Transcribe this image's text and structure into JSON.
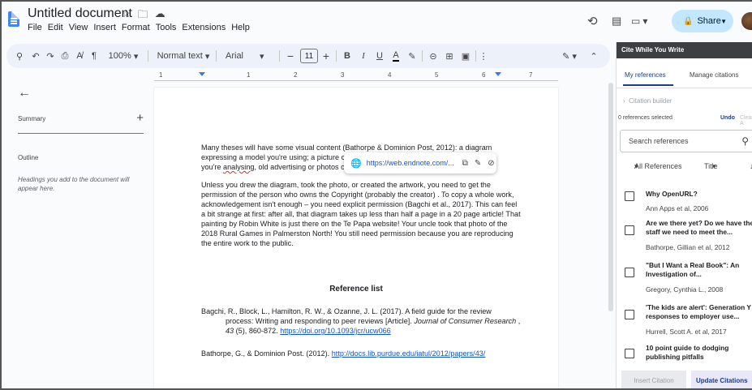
{
  "titlebar": {
    "doc_title": "Untitled document",
    "menu": [
      "File",
      "Edit",
      "View",
      "Insert",
      "Format",
      "Tools",
      "Extensions",
      "Help"
    ],
    "share_label": "Share"
  },
  "toolbar": {
    "zoom": "100%",
    "style": "Normal text",
    "font": "Arial",
    "font_size": "11",
    "bold": "B",
    "italic": "I",
    "underline": "U",
    "text_color": "A"
  },
  "ruler": [
    "1",
    "1",
    "2",
    "3",
    "4",
    "5",
    "6",
    "7"
  ],
  "left_panel": {
    "summary": "Summary",
    "outline": "Outline",
    "outline_hint": "Headings you add to the document will appear here."
  },
  "document": {
    "para1_a": "Many theses will have some visual content (Bathorpe & Dominion Post, 2012): a diagram expressing a model you're using; a picture c",
    "para1_b": "you're ",
    "para1_squiggle": "analysing",
    "para1_c": ", old advertising or photos c",
    "para2": "Unless you drew the diagram, took the photo, or created the artwork, you need to get the permission of the person who owns the Copyright (probably the creator) . To copy a whole work, acknowledgement isn't enough – you need explicit permission (Bagchi et al., 2017). This can feel a bit strange at first: after all, that diagram takes up less than half a page in a 20 page article! That painting by Robin White is just there on the Te Papa website! Your uncle took that photo of the 2018 Rural Games in Palmerston North! You still need permission because you are reproducing the entire work to the public.",
    "reference_heading": "Reference list",
    "ref1_a": "Bagchi, R., Block, L., Hamilton, R. W., & Ozanne, J. L. (2017). A field guide for the review",
    "ref1_b": "process: Writing and responding to peer reviews [Article].",
    "ref1_journal": "Journal of Consumer Research",
    "ref1_c": " ,",
    "ref1_vol": "43",
    "ref1_d": " (5), 860-872. ",
    "ref1_link": "https://doi.org/10.1093/jcr/ucw066",
    "ref2_a": "Bathorpe, G., & Dominion Post. (2012).  ",
    "ref2_link": "http://docs.lib.purdue.edu/iatul/2012/papers/43/",
    "link_chip": "https://web.endnote.com/..."
  },
  "side_panel": {
    "header": "Cite While You Write",
    "tabs": [
      "My references",
      "Manage citations"
    ],
    "citation_builder": "Citation builder",
    "selected": "0 references selected",
    "undo": "Undo",
    "clear": "Clear A",
    "search_placeholder": "Search references",
    "filter_all": "All References",
    "filter_title": "Title",
    "references": [
      {
        "title": "Why OpenURL?",
        "author": "Ann Apps et al, 2006"
      },
      {
        "title": "Are we there yet? Do we have the staff we need to meet the...",
        "author": "Bathorpe, Gillian et al, 2012"
      },
      {
        "title": "\"But I Want a Real Book\": An Investigation of...",
        "author": "Gregory, Cynthia L., 2008"
      },
      {
        "title": "'The kids are alert': Generation Y responses to employer use...",
        "author": "Hurrell, Scott A. et al, 2017"
      },
      {
        "title": "10 point guide to dodging publishing pitfalls",
        "author": ""
      }
    ],
    "insert_citation": "Insert Citation",
    "update_citations": "Update Citations"
  }
}
